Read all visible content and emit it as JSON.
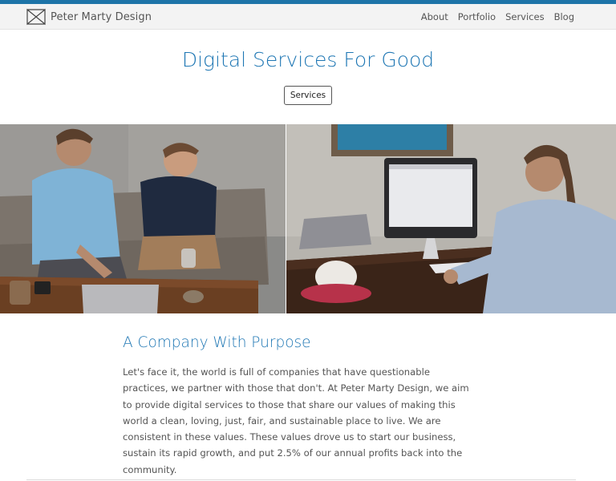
{
  "colors": {
    "accent": "#1d74a8",
    "heading": "#1f77b4",
    "nav_bg": "#f3f3f3",
    "text": "#555555"
  },
  "brand": {
    "name": "Peter Marty Design",
    "logo_icon": "bowtie-logo-icon"
  },
  "nav": {
    "items": [
      "About",
      "Portfolio",
      "Services",
      "Blog"
    ]
  },
  "hero": {
    "title": "Digital Services For Good",
    "button_label": "Services"
  },
  "photos": {
    "left": {
      "subject": "two-men-talking-on-couch-photo"
    },
    "right": {
      "subject": "man-working-at-imac-photo"
    }
  },
  "about": {
    "title": "A Company With Purpose",
    "body": "Let's face it, the world is full of companies that have questionable practices, we partner with those that don't. At Peter Marty Design, we aim to provide digital services to those that share our values of making this world a clean, loving, just, fair, and sustainable place to live. We are consistent in these values. These values drove us to start our business, sustain its rapid growth, and put 2.5% of our annual profits back into the community."
  }
}
